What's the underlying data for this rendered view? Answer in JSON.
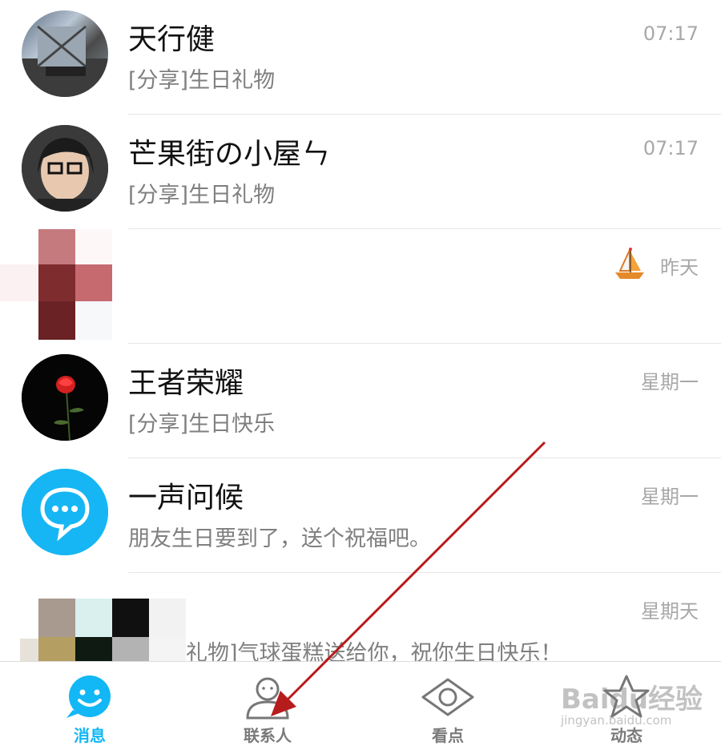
{
  "conversations": [
    {
      "name": "天行健",
      "message": "[分享]生日礼物",
      "time": "07:17"
    },
    {
      "name": "芒果街の小屋ㄣ",
      "message": "[分享]生日礼物",
      "time": "07:17"
    },
    {
      "name": "",
      "message": "",
      "time": "昨天"
    },
    {
      "name": "王者荣耀",
      "message": "[分享]生日快乐",
      "time": "星期一"
    },
    {
      "name": "一声问候",
      "message": "朋友生日要到了，送个祝福吧。",
      "time": "星期一"
    },
    {
      "name": "",
      "message": "礼物]气球蛋糕送给你，祝你生日快乐！",
      "time": "星期天"
    }
  ],
  "tabs": [
    {
      "label": "消息",
      "icon": "message-icon",
      "active": true
    },
    {
      "label": "联系人",
      "icon": "contacts-icon",
      "active": false
    },
    {
      "label": "看点",
      "icon": "eye-icon",
      "active": false
    },
    {
      "label": "动态",
      "icon": "star-icon",
      "active": false
    }
  ],
  "watermark": {
    "title": "Baidu经验",
    "url": "jingyan.baidu.com"
  },
  "colors": {
    "accent": "#12b7f5",
    "annotation_arrow": "#b71c1c"
  }
}
